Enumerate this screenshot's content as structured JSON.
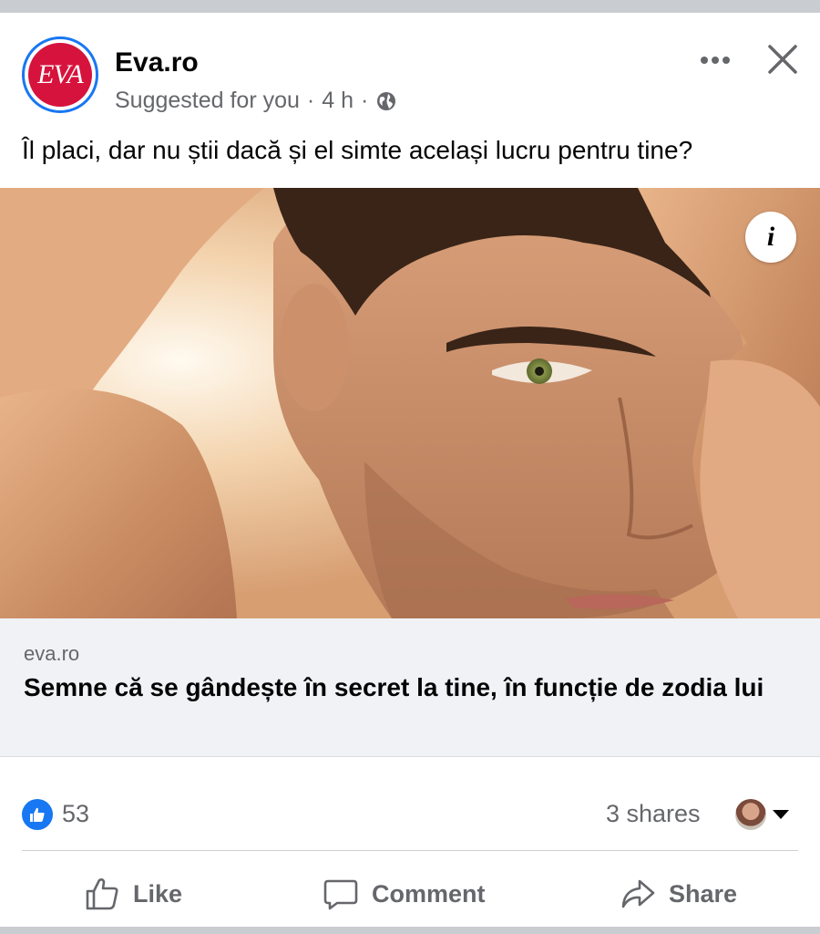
{
  "post": {
    "page_name": "Eva.ro",
    "avatar_text": "EVA",
    "meta": {
      "suggested": "Suggested for you",
      "separator1": "·",
      "time": "4 h",
      "separator2": "·",
      "audience_icon": "globe-icon"
    },
    "text": "Îl placi, dar nu știi dacă și el simte același lucru pentru tine?",
    "image": {
      "description_icon": "info-icon",
      "info_label": "i"
    },
    "link": {
      "domain": "eva.ro",
      "title": "Semne că se gândește în secret la tine, în funcție de zodia lui"
    },
    "reactions": {
      "count": "53",
      "shares": "3 shares"
    },
    "actions": {
      "like": "Like",
      "comment": "Comment",
      "share": "Share"
    }
  },
  "colors": {
    "accent": "#1877f2",
    "brand": "#d6133d",
    "muted_text": "#65676b",
    "link_bg": "#f0f2f5"
  }
}
